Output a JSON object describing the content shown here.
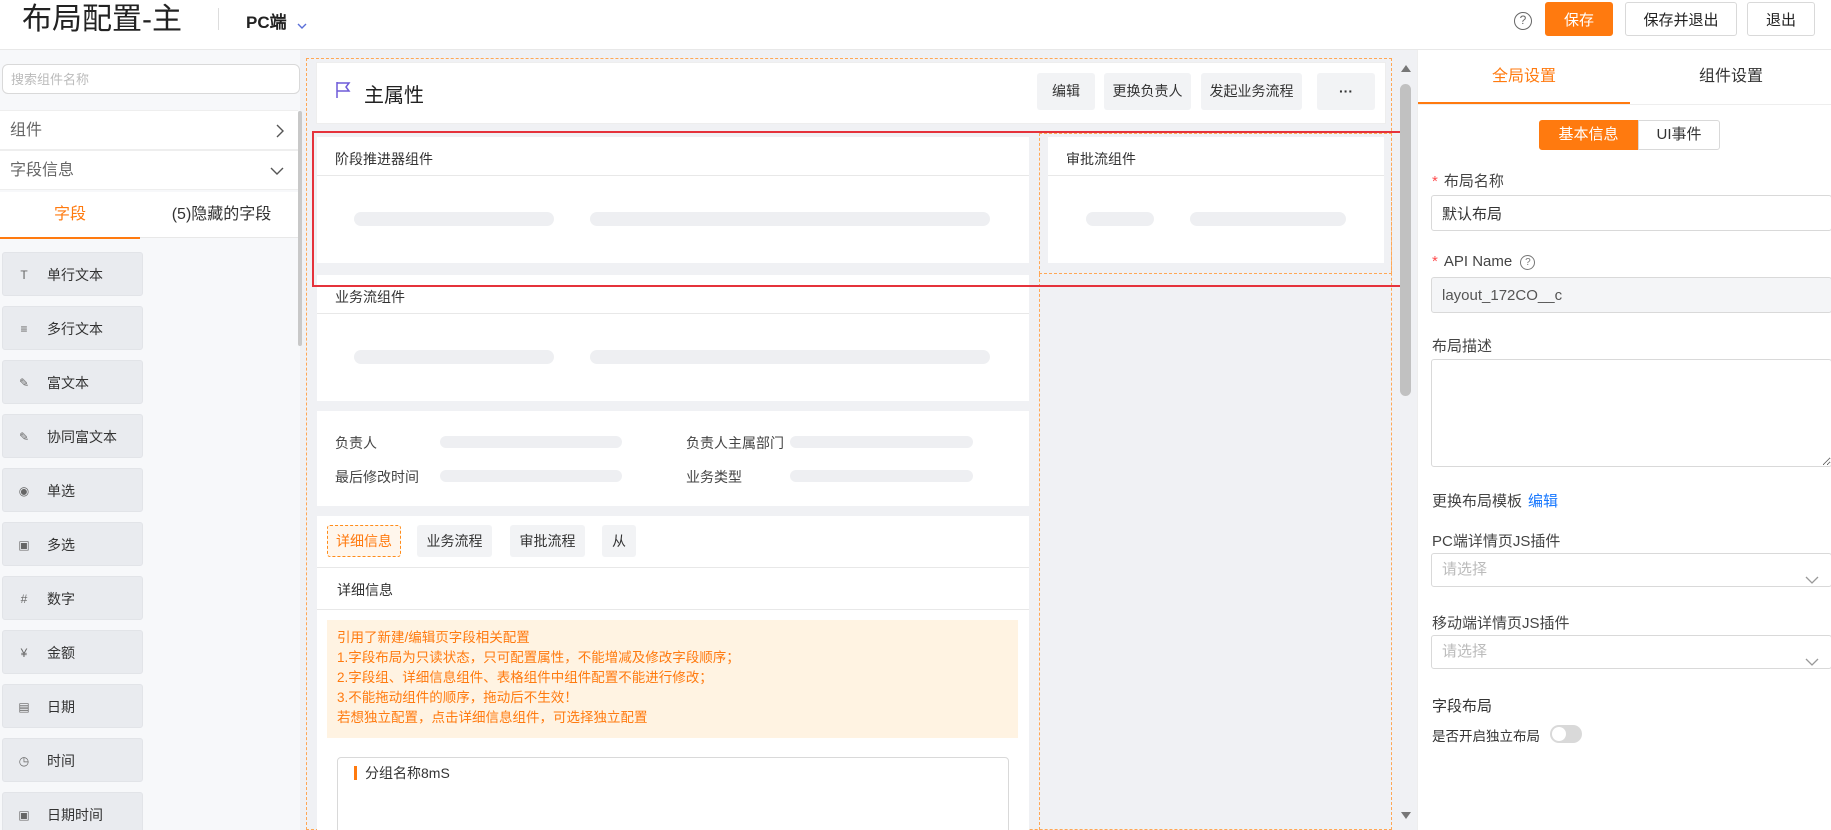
{
  "header": {
    "title": "布局配置-主",
    "platform": "PC端",
    "help": "?",
    "save": "保存",
    "save_exit": "保存并退出",
    "exit": "退出"
  },
  "left_panel": {
    "search_placeholder": "搜索组件名称",
    "components_label": "组件",
    "field_info_label": "字段信息",
    "tabs": [
      "字段",
      "(5)隐藏的字段"
    ],
    "fields": [
      {
        "label": "单行文本",
        "icon": "T"
      },
      {
        "label": "多行文本",
        "icon": "≡"
      },
      {
        "label": "富文本",
        "icon": "✎"
      },
      {
        "label": "协同富文本",
        "icon": "✎"
      },
      {
        "label": "单选",
        "icon": "◉"
      },
      {
        "label": "多选",
        "icon": "▣"
      },
      {
        "label": "数字",
        "icon": "#"
      },
      {
        "label": "金额",
        "icon": "¥"
      },
      {
        "label": "日期",
        "icon": "▤"
      },
      {
        "label": "时间",
        "icon": "◷"
      },
      {
        "label": "日期时间",
        "icon": "▣"
      }
    ]
  },
  "canvas": {
    "main_title": "主属性",
    "actions": [
      "编辑",
      "更换负责人",
      "发起业务流程",
      "···"
    ],
    "stage_component": "阶段推进器组件",
    "approval_component": "审批流组件",
    "business_component": "业务流组件",
    "info_labels": [
      "负责人",
      "负责人主属部门",
      "最后修改时间",
      "业务类型"
    ],
    "tabs": [
      "详细信息",
      "业务流程",
      "审批流程",
      "从"
    ],
    "detail_title": "详细信息",
    "notice_lines": [
      "引用了新建/编辑页字段相关配置",
      "1.字段布局为只读状态，只可配置属性，不能增减及修改字段顺序；",
      "2.字段组、详细信息组件、表格组件中组件配置不能进行修改；",
      "3.不能拖动组件的顺序，拖动后不生效！",
      "若想独立配置，点击详细信息组件，可选择独立配置"
    ],
    "group_name": "分组名称8mS"
  },
  "right_panel": {
    "tabs": [
      "全局设置",
      "组件设置"
    ],
    "segments": [
      "基本信息",
      "UI事件"
    ],
    "layout_name_label": "布局名称",
    "layout_name_value": "默认布局",
    "api_name_label": "API Name",
    "api_name_value": "layout_172CO__c",
    "desc_label": "布局描述",
    "template_label": "更换布局模板",
    "template_edit": "编辑",
    "pc_plugin_label": "PC端详情页JS插件",
    "pc_plugin_placeholder": "请选择",
    "mobile_plugin_label": "移动端详情页JS插件",
    "mobile_plugin_placeholder": "请选择",
    "field_layout_label": "字段布局",
    "independent_label": "是否开启独立布局"
  },
  "colors": {
    "accent": "#ff7a0f",
    "highlight_box": "#e5323b",
    "link": "#1677ff"
  }
}
